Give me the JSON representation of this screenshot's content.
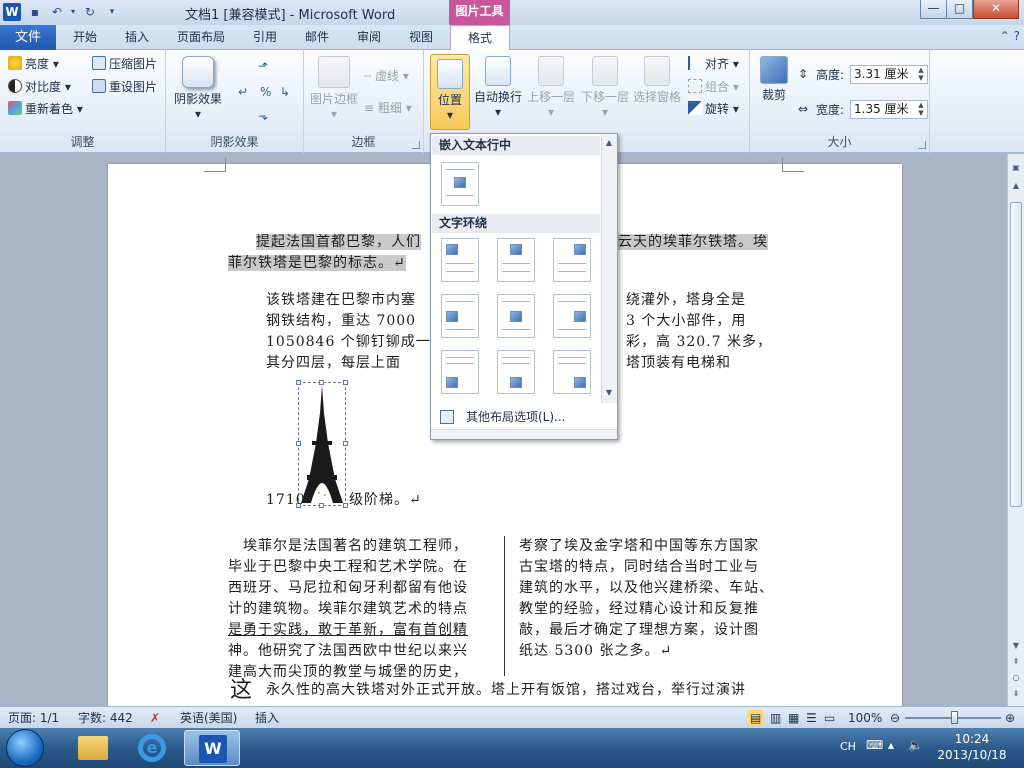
{
  "title_bar": {
    "doc_title": "文档1 [兼容模式] - Microsoft Word",
    "context_tab_group": "图片工具",
    "win_min": "—",
    "win_max": "□",
    "win_close": "✕"
  },
  "tabs": {
    "file": "文件",
    "items": [
      "开始",
      "插入",
      "页面布局",
      "引用",
      "邮件",
      "审阅",
      "视图"
    ],
    "format": "格式"
  },
  "ribbon": {
    "adjust": {
      "label": "调整",
      "brightness": "亮度",
      "contrast": "对比度",
      "recolor": "重新着色",
      "compress": "压缩图片",
      "reset": "重设图片"
    },
    "shadow": {
      "label": "阴影效果",
      "shadow_btn": "阴影效果"
    },
    "border": {
      "label": "边框",
      "picture_border": "图片边框",
      "dashes": "虚线",
      "weight": "粗细"
    },
    "arrange": {
      "position": "位置",
      "wrap": "自动换行",
      "bring_forward": "上移一层",
      "send_backward": "下移一层",
      "selection_pane": "选择窗格",
      "align": "对齐",
      "group": "组合",
      "rotate": "旋转"
    },
    "size": {
      "label": "大小",
      "crop": "裁剪",
      "height_label": "高度:",
      "height_value": "3.31 厘米",
      "width_label": "宽度:",
      "width_value": "1.35 厘米"
    }
  },
  "position_menu": {
    "inline_header": "嵌入文本行中",
    "wrap_header": "文字环绕",
    "more_options": "其他布局选项(L)..."
  },
  "document": {
    "p1_line1": "提起法国首都巴黎，人们",
    "p1_line1_tail": "云天的埃菲尔铁塔。埃",
    "p1_line2": "菲尔铁塔是巴黎的标志。↵",
    "p2_l1": "该铁塔建在巴黎市内塞",
    "p2_l1_tail": "绕灌外，塔身全是",
    "p2_l2": "钢铁结构，重达 7000",
    "p2_l2_tail": "3 个大小部件，用",
    "p2_l3": "1050846 个铆钉铆成一",
    "p2_l3_tail": "彩，高 320.7 米多，",
    "p2_l4": "其分四层，每层上面",
    "p2_l4_tail": "塔顶装有电梯和",
    "p2_l5_a": "1710",
    "p2_l5_b": "级阶梯。↵",
    "col1": [
      "　埃菲尔是法国著名的建筑工程师，",
      "毕业于巴黎中央工程和艺术学院。在",
      "西班牙、马尼拉和匈牙利都留有他设",
      "计的建筑物。埃菲尔建筑艺术的特点",
      "是勇于实践，敢于革新，富有首创精",
      "神。他研究了法国西欧中世纪以来兴",
      "建高大而尖顶的教堂与城堡的历史，"
    ],
    "col2": [
      "考察了埃及金字塔和中国等东方国家",
      "古宝塔的特点，同时结合当时工业与",
      "建筑的水平，以及他兴建桥梁、车站、",
      "教堂的经验，经过精心设计和反复推",
      "敲，最后才确定了理想方案，设计图",
      "纸达 5300 张之多。↵"
    ],
    "last_line_char": "这",
    "last_line": "永久性的高大铁塔对外正式开放。塔上开有饭馆，搭过戏台，举行过演讲"
  },
  "status_bar": {
    "page": "页面: 1/1",
    "words": "字数: 442",
    "language": "英语(美国)",
    "mode": "插入",
    "zoom": "100%"
  },
  "taskbar": {
    "ime": "CH",
    "time": "10:24",
    "date": "2013/10/18"
  },
  "colors": {
    "accent": "#1f58ad",
    "context_tab": "#c8569b",
    "position_highlight": "#f8c95b"
  }
}
